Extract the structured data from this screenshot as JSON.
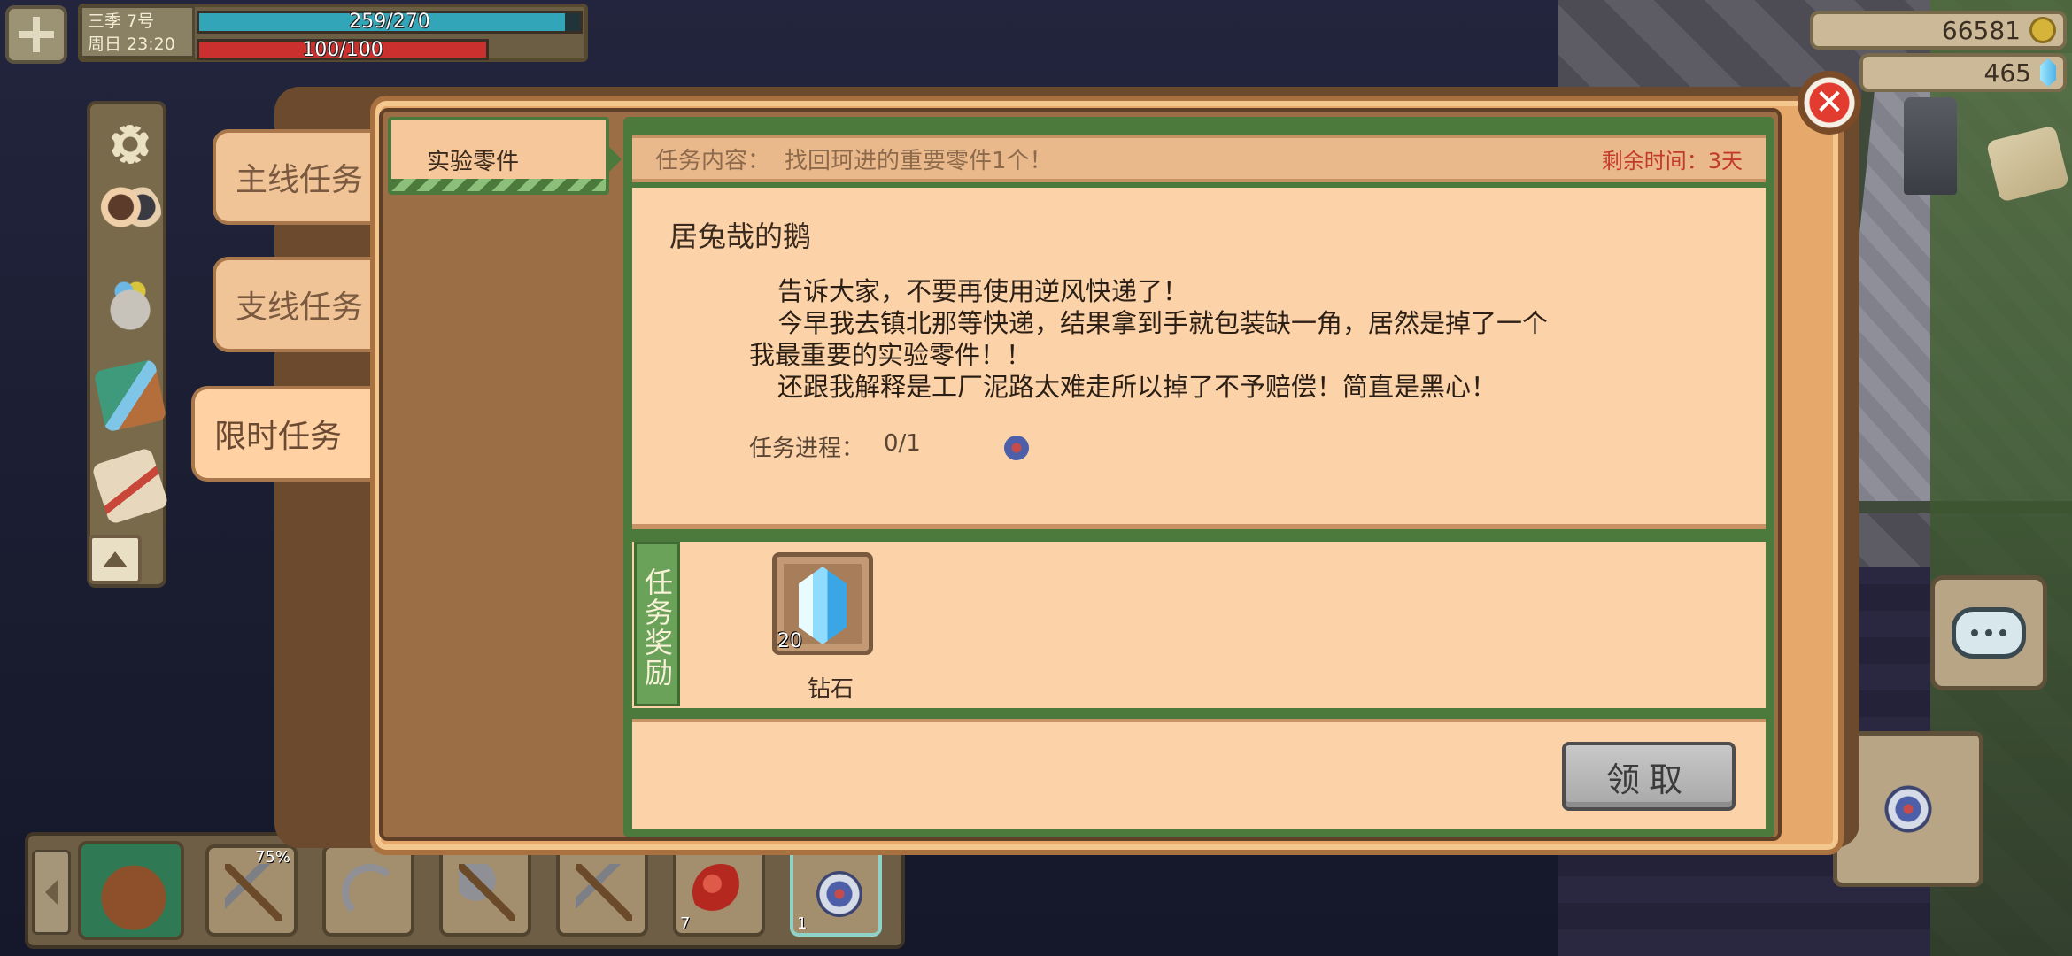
{
  "hud": {
    "season_day": "三季    7号",
    "weekday_time": "周日  23:20",
    "hp_text": "259/270",
    "hp_ratio": 0.96,
    "mp_text": "100/100",
    "mp_ratio": 1.0
  },
  "currency": {
    "gold": "66581",
    "diamonds": "465"
  },
  "quest_categories": [
    {
      "label": "主线任务",
      "active": false
    },
    {
      "label": "支线任务",
      "active": false
    },
    {
      "label": "限时任务",
      "active": true
    }
  ],
  "quest_list": [
    {
      "title": "实验零件",
      "selected": true
    }
  ],
  "quest_detail": {
    "content_label": "任务内容：",
    "content_value": "找回珂进的重要零件1个！",
    "remaining_time": "剩余时间：3天",
    "letter_from": "居兔哉的鹅",
    "letter_lines": [
      "告诉大家，不要再使用逆风快递了！",
      "今早我去镇北那等快递，结果拿到手就包装缺一角，居然是掉了一个",
      "我最重要的实验零件！！",
      "还跟我解释是工厂泥路太难走所以掉了不予赔偿！简直是黑心！"
    ],
    "progress_label": "任务进程：",
    "progress_value": "0/1",
    "progress_icon": "compass-icon"
  },
  "reward": {
    "tag_label": "任务奖励",
    "item_name": "钻石",
    "item_count": "20",
    "item_icon": "diamond-icon"
  },
  "actions": {
    "claim_label": "领取"
  },
  "toolbar": {
    "slots": [
      {
        "icon": "backpack-icon",
        "label": ""
      },
      {
        "icon": "pickaxe-icon",
        "label": "75%"
      },
      {
        "icon": "sickle-icon",
        "label": ""
      },
      {
        "icon": "axe-icon",
        "label": ""
      },
      {
        "icon": "hoe-icon",
        "label": ""
      },
      {
        "icon": "fruit-icon",
        "label": "7"
      },
      {
        "icon": "compass-icon",
        "label": "1"
      }
    ]
  },
  "colors": {
    "dialog_bg": "#e7a96b",
    "panel_green": "#4c7a3c",
    "time_red": "#c43a2a",
    "hp_teal": "#32a5b8",
    "mp_red": "#c9302e"
  }
}
